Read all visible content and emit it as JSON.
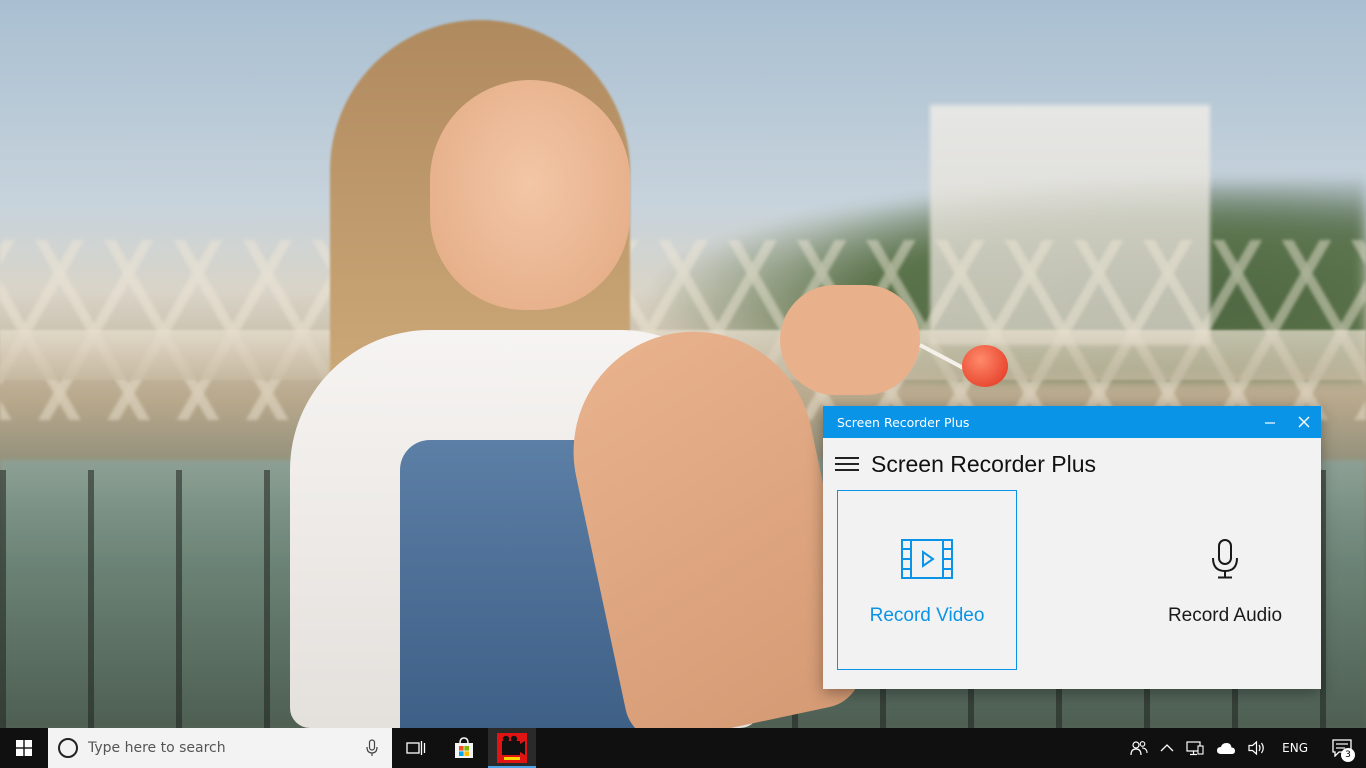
{
  "window": {
    "title": "Screen Recorder Plus",
    "minimize_glyph": "—",
    "close_glyph": "✕"
  },
  "app": {
    "header_title": "Screen Recorder Plus",
    "tiles": [
      {
        "label": "Record Video",
        "icon": "film-icon",
        "selected": true
      },
      {
        "label": "Record Audio",
        "icon": "microphone-icon",
        "selected": false
      }
    ]
  },
  "taskbar": {
    "search_placeholder": "Type here to search",
    "pinned": [
      {
        "icon": "task-view-icon"
      },
      {
        "icon": "store-icon"
      },
      {
        "icon": "screen-recorder-app-icon",
        "active": true
      }
    ],
    "tray": {
      "language": "ENG",
      "notification_count": "3"
    }
  },
  "colors": {
    "accent": "#0a94e8",
    "taskbar": "#101010",
    "window_bg": "#f2f2f2"
  }
}
